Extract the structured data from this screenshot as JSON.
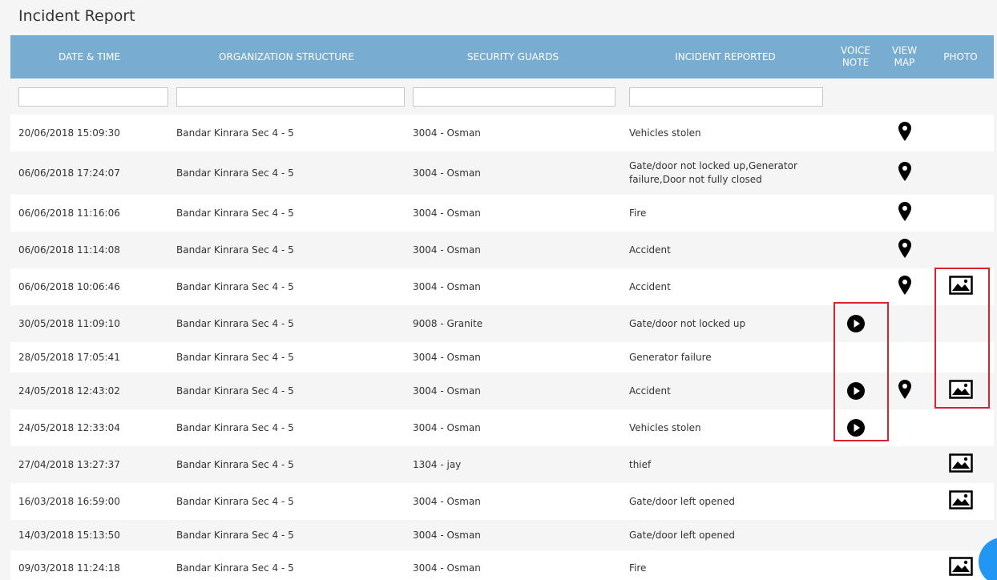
{
  "page": {
    "title": "Incident Report"
  },
  "table": {
    "headers": {
      "datetime": "DATE & TIME",
      "org": "ORGANIZATION STRUCTURE",
      "guards": "SECURITY GUARDS",
      "incident": "INCIDENT REPORTED",
      "voice_line1": "VOICE",
      "voice_line2": "NOTE",
      "map_line1": "VIEW",
      "map_line2": "MAP",
      "photo": "PHOTO"
    },
    "filters": {
      "datetime": "",
      "org": "",
      "guards": "",
      "incident": ""
    },
    "rows": [
      {
        "datetime": "20/06/2018 15:09:30",
        "org": "Bandar Kinrara Sec 4 - 5",
        "guard": "3004 - Osman",
        "incident": "Vehicles stolen",
        "voice": false,
        "map": true,
        "photo": false
      },
      {
        "datetime": "06/06/2018 17:24:07",
        "org": "Bandar Kinrara Sec 4 - 5",
        "guard": "3004 - Osman",
        "incident": "Gate/door not locked up,Generator failure,Door not fully closed",
        "voice": false,
        "map": true,
        "photo": false
      },
      {
        "datetime": "06/06/2018 11:16:06",
        "org": "Bandar Kinrara Sec 4 - 5",
        "guard": "3004 - Osman",
        "incident": "Fire",
        "voice": false,
        "map": true,
        "photo": false
      },
      {
        "datetime": "06/06/2018 11:14:08",
        "org": "Bandar Kinrara Sec 4 - 5",
        "guard": "3004 - Osman",
        "incident": "Accident",
        "voice": false,
        "map": true,
        "photo": false
      },
      {
        "datetime": "06/06/2018 10:06:46",
        "org": "Bandar Kinrara Sec 4 - 5",
        "guard": "3004 - Osman",
        "incident": "Accident",
        "voice": false,
        "map": true,
        "photo": true
      },
      {
        "datetime": "30/05/2018 11:09:10",
        "org": "Bandar Kinrara Sec 4 - 5",
        "guard": "9008 - Granite",
        "incident": "Gate/door not locked up",
        "voice": true,
        "map": false,
        "photo": false
      },
      {
        "datetime": "28/05/2018 17:05:41",
        "org": "Bandar Kinrara Sec 4 - 5",
        "guard": "3004 - Osman",
        "incident": "Generator failure",
        "voice": false,
        "map": false,
        "photo": false
      },
      {
        "datetime": "24/05/2018 12:43:02",
        "org": "Bandar Kinrara Sec 4 - 5",
        "guard": "3004 - Osman",
        "incident": "Accident",
        "voice": true,
        "map": true,
        "photo": true
      },
      {
        "datetime": "24/05/2018 12:33:04",
        "org": "Bandar Kinrara Sec 4 - 5",
        "guard": "3004 - Osman",
        "incident": "Vehicles stolen",
        "voice": true,
        "map": false,
        "photo": false
      },
      {
        "datetime": "27/04/2018 13:27:37",
        "org": "Bandar Kinrara Sec 4 - 5",
        "guard": "1304 - jay",
        "incident": "thief",
        "voice": false,
        "map": false,
        "photo": true
      },
      {
        "datetime": "16/03/2018 16:59:00",
        "org": "Bandar Kinrara Sec 4 - 5",
        "guard": "3004 - Osman",
        "incident": "Gate/door left opened",
        "voice": false,
        "map": false,
        "photo": true
      },
      {
        "datetime": "14/03/2018 15:13:50",
        "org": "Bandar Kinrara Sec 4 - 5",
        "guard": "3004 - Osman",
        "incident": "Gate/door left opened",
        "voice": false,
        "map": false,
        "photo": false
      },
      {
        "datetime": "09/03/2018 11:24:18",
        "org": "Bandar Kinrara Sec 4 - 5",
        "guard": "3004 - Osman",
        "incident": "Fire",
        "voice": false,
        "map": false,
        "photo": true
      }
    ]
  },
  "icons": {
    "voice": "play-icon",
    "map": "map-pin-icon",
    "photo": "image-icon"
  },
  "colors": {
    "header_bg": "#78acd1",
    "highlight": "#d9242f",
    "row_alt": "#f5f5f5",
    "chat": "#2196f3"
  }
}
